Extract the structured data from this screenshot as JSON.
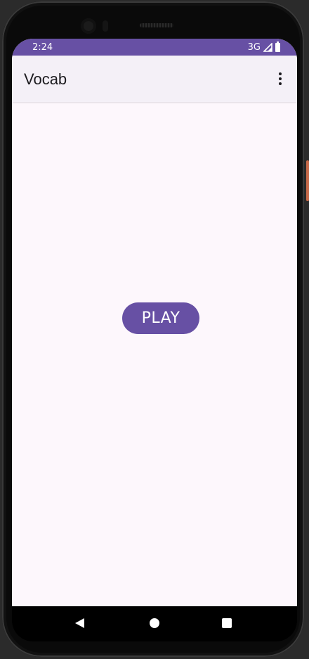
{
  "status_bar": {
    "time": "2:24",
    "network": "3G",
    "background_color": "#6750a4"
  },
  "app_bar": {
    "title": "Vocab",
    "menu_icon": "more-vert-icon"
  },
  "main": {
    "play_label": "PLAY",
    "accent_color": "#6750a4"
  },
  "nav_bar": {
    "icons": [
      "back-icon",
      "home-icon",
      "recent-apps-icon"
    ]
  }
}
